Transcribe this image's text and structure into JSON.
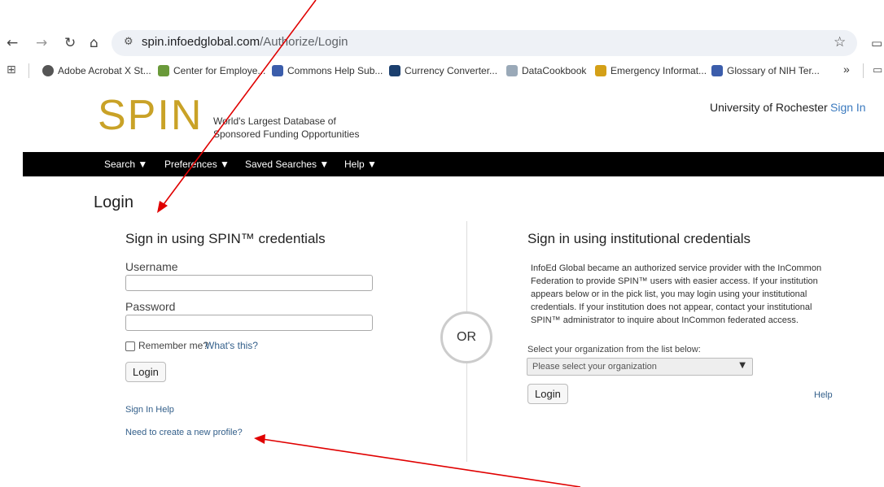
{
  "browser": {
    "url_domain": "spin.infoedglobal.com",
    "url_path": "/Authorize/Login",
    "bookmarks": [
      "Adobe Acrobat X St...",
      "Center for Employe...",
      "Commons Help Sub...",
      "Currency Converter...",
      "DataCookbook",
      "Emergency Informat...",
      "Glossary of NIH Ter..."
    ],
    "more": "»"
  },
  "header": {
    "logo": "SPIN",
    "tagline_line1": "World's Largest Database of",
    "tagline_line2": "Sponsored Funding Opportunities",
    "organization": "University of Rochester",
    "signin": "Sign In"
  },
  "nav": {
    "items": [
      "Search ▼",
      "Preferences ▼",
      "Saved Searches ▼",
      "Help ▼"
    ]
  },
  "page": {
    "title": "Login",
    "left": {
      "heading": "Sign in using SPIN™ credentials",
      "username_label": "Username",
      "password_label": "Password",
      "remember_label": "Remember me?",
      "whats_this": "What's this?",
      "login_button": "Login",
      "signin_help": "Sign In Help",
      "create_profile": "Need to create a new profile?"
    },
    "or": "OR",
    "right": {
      "heading": "Sign in using institutional credentials",
      "description": "InfoEd Global became an authorized service provider with the InCommon Federation to provide SPIN™ users with easier access. If your institution appears below or in the pick list, you may login using your institutional credentials. If your institution does not appear, contact your institutional SPIN™ administrator to inquire about InCommon federated access.",
      "select_label": "Select your organization from the list below:",
      "select_value": "Please select your organization",
      "login_button": "Login",
      "help": "Help"
    }
  },
  "colors": {
    "logo": "#c9a227",
    "annotation_arrow": "#e00000",
    "navbar": "#000000"
  }
}
